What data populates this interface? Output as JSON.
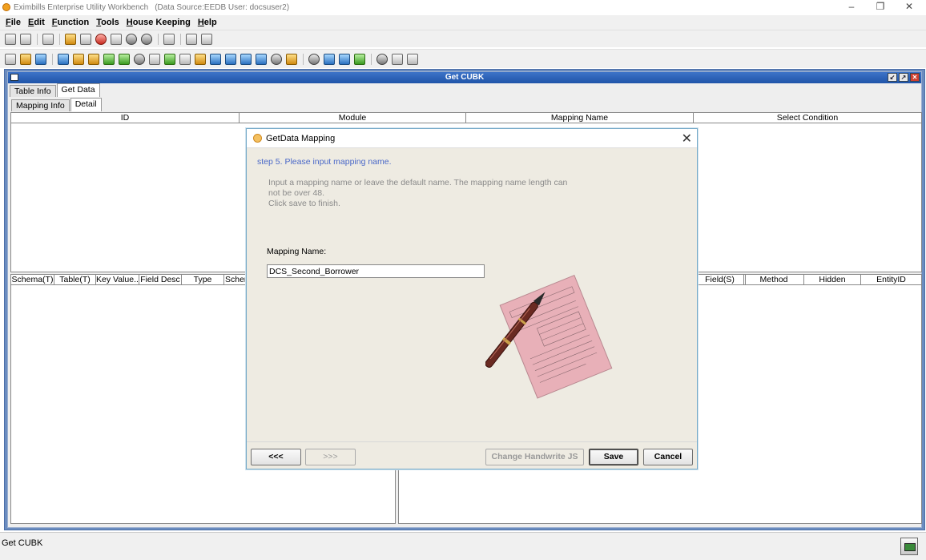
{
  "window": {
    "title": "Eximbills Enterprise Utility Workbench",
    "datasource": "(Data Source:EEDB User: docsuser2)",
    "controls": [
      "–",
      "❐",
      "✕"
    ]
  },
  "menu": [
    "File",
    "Edit",
    "Function",
    "Tools",
    "House Keeping",
    "Help"
  ],
  "frame": {
    "title": "Get CUBK",
    "buttons": [
      "↙",
      "↗",
      "✕"
    ]
  },
  "outer_tabs": [
    "Table Info",
    "Get Data"
  ],
  "inner_tabs": [
    "Mapping Info",
    "Detail"
  ],
  "top_table": {
    "columns": [
      "ID",
      "Module",
      "Mapping Name",
      "Select Condition"
    ]
  },
  "bottom_left_table": {
    "columns": [
      "Schema(T)",
      "Table(T)",
      "Key Value...",
      "Field Desc",
      "Type",
      "Scher"
    ]
  },
  "bottom_right_table": {
    "columns": [
      "Field(S)",
      "Method",
      "Hidden",
      "EntityID"
    ]
  },
  "dialog": {
    "title": "GetData Mapping",
    "step": "step 5. Please input mapping name.",
    "instructions": [
      "Input a mapping name or leave the default name. The mapping name length can",
      "not be over 48.",
      "Click save to finish."
    ],
    "field_label": "Mapping Name:",
    "field_value": "DCS_Second_Borrower",
    "buttons": {
      "back": "<<<",
      "next": ">>>",
      "change": "Change Handwrite JS",
      "save": "Save",
      "cancel": "Cancel"
    }
  },
  "status": {
    "text": "Get CUBK"
  }
}
